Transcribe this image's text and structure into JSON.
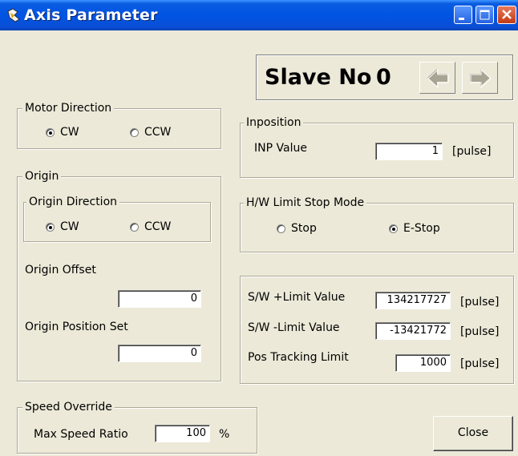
{
  "window": {
    "title": "Axis Parameter",
    "icon": "app-icon",
    "controls": [
      "minimize-icon",
      "maximize-icon",
      "close-icon"
    ]
  },
  "slave": {
    "label": "Slave No",
    "number": "0"
  },
  "motor_direction": {
    "title": "Motor Direction",
    "options": [
      "CW",
      "CCW"
    ],
    "selected": "CW"
  },
  "origin": {
    "title": "Origin",
    "direction": {
      "title": "Origin Direction",
      "options": [
        "CW",
        "CCW"
      ],
      "selected": "CW"
    },
    "offset_label": "Origin Offset",
    "offset_value": "0",
    "position_set_label": "Origin Position Set",
    "position_set_value": "0"
  },
  "inposition": {
    "title": "Inposition",
    "inp_label": "INP Value",
    "inp_value": "1",
    "unit": "[pulse]"
  },
  "hw_limit": {
    "title": "H/W Limit Stop Mode",
    "options": [
      "Stop",
      "E-Stop"
    ],
    "selected": "E-Stop"
  },
  "sw_limits": {
    "plus_label": "S/W +Limit Value",
    "plus_value": "134217727",
    "minus_label": "S/W -Limit Value",
    "minus_value": "-13421772",
    "tracking_label": "Pos Tracking Limit",
    "tracking_value": "1000",
    "unit": "[pulse]"
  },
  "speed_override": {
    "title": "Speed Override",
    "ratio_label": "Max Speed Ratio",
    "ratio_value": "100",
    "unit": "%"
  },
  "buttons": {
    "close": "Close"
  },
  "colors": {
    "titlebar": "#0054e3",
    "dialog_bg": "#ece9d8",
    "arrow_disabled": "#a8a595"
  }
}
